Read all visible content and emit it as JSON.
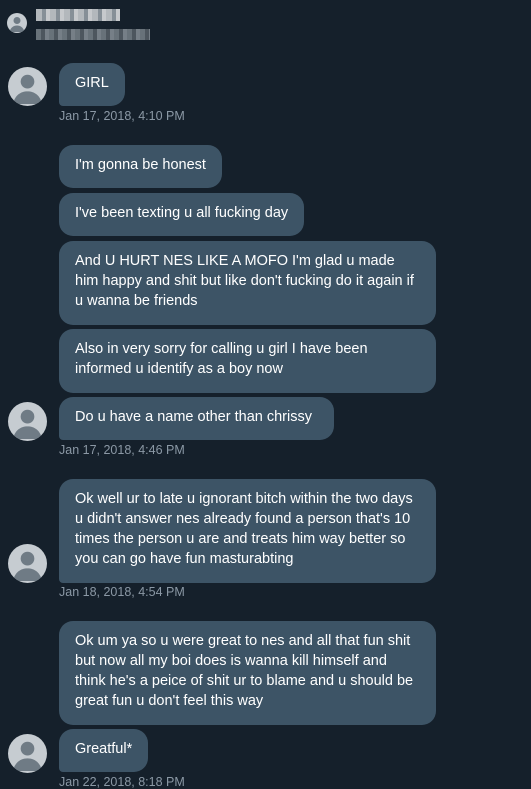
{
  "messages": [
    "GIRL",
    "I'm gonna be honest",
    "I've been texting u all fucking day",
    "And U HURT NES LIKE A MOFO I'm glad u made him happy and shit but like don't fucking do it again if u wanna be friends",
    "Also in very sorry for calling u girl I have been informed u identify as a boy now",
    "Do u have a name other than chrissy",
    "Ok well ur to late u ignorant bitch within the two days u didn't answer nes already found a person that's 10 times the person u are and treats him way better so you can go have fun masturabting",
    "Ok um ya so u were great to nes and all that fun shit but now all my boi does is wanna kill himself and think he's a peice of shit ur to blame and u should be great fun u don't feel this way",
    "Greatful*"
  ],
  "timestamps": [
    "Jan 17, 2018, 4:10 PM",
    "Jan 17, 2018, 4:46 PM",
    "Jan 18, 2018, 4:54 PM",
    "Jan 22, 2018, 8:18 PM"
  ],
  "colors": {
    "background": "#15202b",
    "bubble": "#3d5466",
    "timestamp": "#8b98a5"
  }
}
